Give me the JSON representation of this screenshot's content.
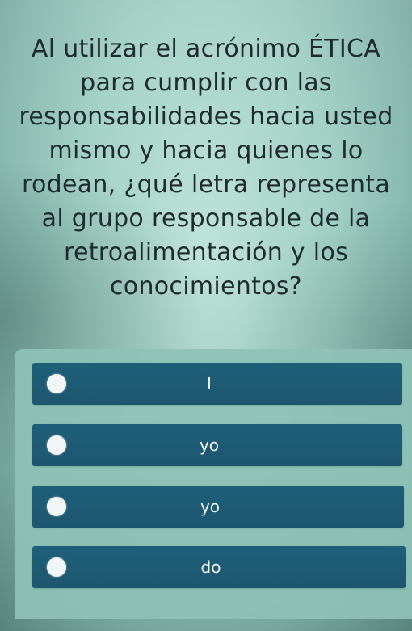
{
  "question": {
    "text": "Al utilizar el acrónimo ÉTICA para cumplir con las responsabilidades hacia usted mismo y hacia quienes lo rodean, ¿qué letra representa al grupo responsable de la retroalimentación y los conocimientos?"
  },
  "answers": [
    {
      "label": "I"
    },
    {
      "label": "yo"
    },
    {
      "label": "yo"
    },
    {
      "label": "do"
    }
  ],
  "colors": {
    "answer_background": "#1f5f7a",
    "radio_fill": "#f2f6f6",
    "question_text": "#1f2b2e",
    "page_background": "#a9d6ca"
  }
}
